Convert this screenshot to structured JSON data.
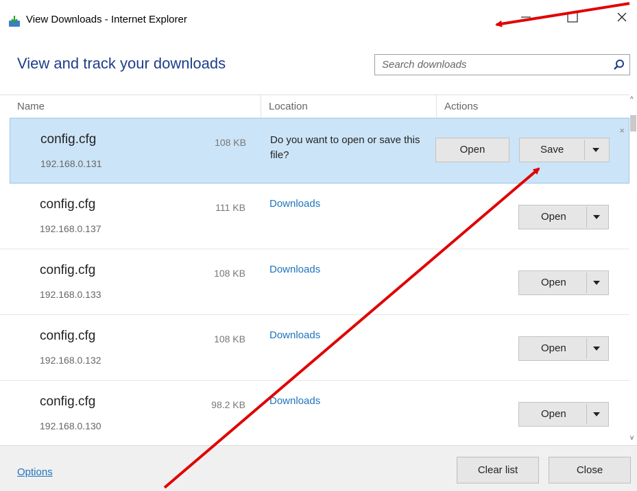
{
  "window": {
    "title": "View Downloads - Internet Explorer"
  },
  "header": {
    "heading": "View and track your downloads"
  },
  "search": {
    "placeholder": "Search downloads"
  },
  "columns": {
    "name": "Name",
    "location": "Location",
    "actions": "Actions"
  },
  "items": [
    {
      "name": "config.cfg",
      "source": "192.168.0.131",
      "size": "108 KB",
      "prompt": "Do you want to open or save this file?",
      "actions": {
        "open": "Open",
        "save": "Save"
      }
    },
    {
      "name": "config.cfg",
      "source": "192.168.0.137",
      "size": "111 KB",
      "location": "Downloads",
      "action": "Open"
    },
    {
      "name": "config.cfg",
      "source": "192.168.0.133",
      "size": "108 KB",
      "location": "Downloads",
      "action": "Open"
    },
    {
      "name": "config.cfg",
      "source": "192.168.0.132",
      "size": "108 KB",
      "location": "Downloads",
      "action": "Open"
    },
    {
      "name": "config.cfg",
      "source": "192.168.0.130",
      "size": "98.2 KB",
      "location": "Downloads",
      "action": "Open"
    }
  ],
  "footer": {
    "options": "Options",
    "clear_list": "Clear list",
    "close": "Close"
  },
  "icons": {
    "app": "ie-download-icon",
    "search": "search-icon",
    "minimize": "minimize-icon",
    "maximize": "maximize-icon",
    "close": "close-icon",
    "dismiss": "dismiss-icon",
    "dropdown": "chevron-down-icon"
  },
  "colors": {
    "heading": "#1e3e8a",
    "link": "#1e73be",
    "selected_row": "#cce4f7",
    "annotation_arrow": "#e00000"
  }
}
